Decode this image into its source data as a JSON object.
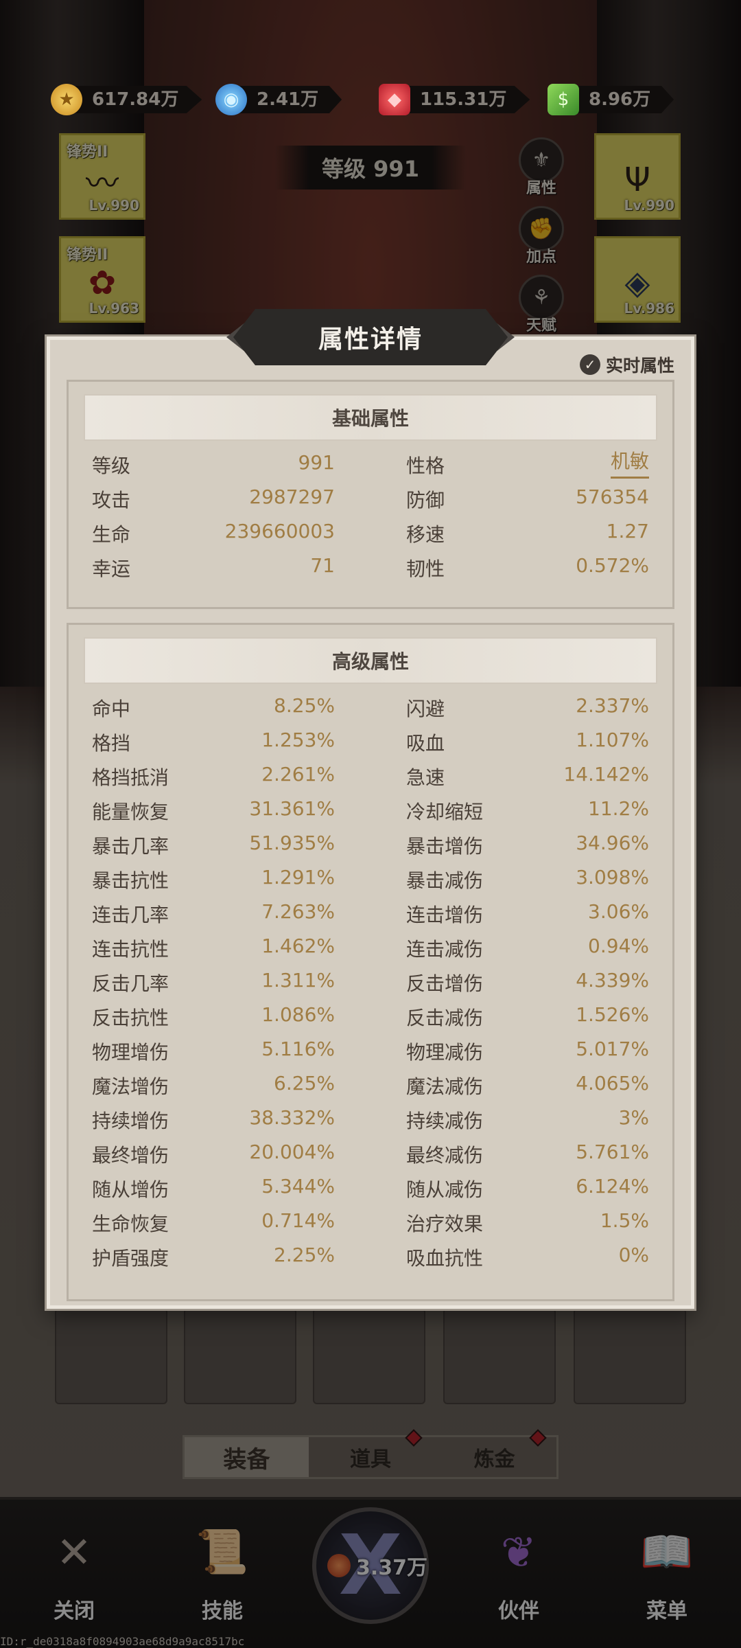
{
  "currencies": [
    {
      "icon": "gold-coin-icon",
      "glyph": "★",
      "value": "617.84万"
    },
    {
      "icon": "blue-orb-icon",
      "glyph": "◉",
      "value": "2.41万"
    },
    {
      "icon": "red-gem-icon",
      "glyph": "◆",
      "value": "115.31万"
    },
    {
      "icon": "green-cash-icon",
      "glyph": "$",
      "value": "8.96万"
    }
  ],
  "equipment": {
    "left": [
      {
        "name": "锋势II",
        "level": "Lv.990"
      },
      {
        "name": "锋势II",
        "level": "Lv.963"
      }
    ],
    "right": [
      {
        "level": "Lv.990"
      },
      {
        "level": "Lv.986"
      }
    ]
  },
  "level_banner": "等级 991",
  "side_buttons": [
    "属性",
    "加点",
    "天赋"
  ],
  "modal": {
    "title": "属性详情",
    "realtime_label": "实时属性",
    "basic": {
      "title": "基础属性",
      "rows": [
        [
          {
            "k": "等级",
            "v": "991"
          },
          {
            "k": "性格",
            "v": "机敏"
          }
        ],
        [
          {
            "k": "攻击",
            "v": "2987297"
          },
          {
            "k": "防御",
            "v": "576354"
          }
        ],
        [
          {
            "k": "生命",
            "v": "239660003"
          },
          {
            "k": "移速",
            "v": "1.27"
          }
        ],
        [
          {
            "k": "幸运",
            "v": "71"
          },
          {
            "k": "韧性",
            "v": "0.572%"
          }
        ]
      ]
    },
    "advanced": {
      "title": "高级属性",
      "rows": [
        [
          {
            "k": "命中",
            "v": "8.25%"
          },
          {
            "k": "闪避",
            "v": "2.337%"
          }
        ],
        [
          {
            "k": "格挡",
            "v": "1.253%"
          },
          {
            "k": "吸血",
            "v": "1.107%"
          }
        ],
        [
          {
            "k": "格挡抵消",
            "v": "2.261%"
          },
          {
            "k": "急速",
            "v": "14.142%"
          }
        ],
        [
          {
            "k": "能量恢复",
            "v": "31.361%"
          },
          {
            "k": "冷却缩短",
            "v": "11.2%"
          }
        ],
        [
          {
            "k": "暴击几率",
            "v": "51.935%"
          },
          {
            "k": "暴击增伤",
            "v": "34.96%"
          }
        ],
        [
          {
            "k": "暴击抗性",
            "v": "1.291%"
          },
          {
            "k": "暴击减伤",
            "v": "3.098%"
          }
        ],
        [
          {
            "k": "连击几率",
            "v": "7.263%"
          },
          {
            "k": "连击增伤",
            "v": "3.06%"
          }
        ],
        [
          {
            "k": "连击抗性",
            "v": "1.462%"
          },
          {
            "k": "连击减伤",
            "v": "0.94%"
          }
        ],
        [
          {
            "k": "反击几率",
            "v": "1.311%"
          },
          {
            "k": "反击增伤",
            "v": "4.339%"
          }
        ],
        [
          {
            "k": "反击抗性",
            "v": "1.086%"
          },
          {
            "k": "反击减伤",
            "v": "1.526%"
          }
        ],
        [
          {
            "k": "物理增伤",
            "v": "5.116%"
          },
          {
            "k": "物理减伤",
            "v": "5.017%"
          }
        ],
        [
          {
            "k": "魔法增伤",
            "v": "6.25%"
          },
          {
            "k": "魔法减伤",
            "v": "4.065%"
          }
        ],
        [
          {
            "k": "持续增伤",
            "v": "38.332%"
          },
          {
            "k": "持续减伤",
            "v": "3%"
          }
        ],
        [
          {
            "k": "最终增伤",
            "v": "20.004%"
          },
          {
            "k": "最终减伤",
            "v": "5.761%"
          }
        ],
        [
          {
            "k": "随从增伤",
            "v": "5.344%"
          },
          {
            "k": "随从减伤",
            "v": "6.124%"
          }
        ],
        [
          {
            "k": "生命恢复",
            "v": "0.714%"
          },
          {
            "k": "治疗效果",
            "v": "1.5%"
          }
        ],
        [
          {
            "k": "护盾强度",
            "v": "2.25%"
          },
          {
            "k": "吸血抗性",
            "v": "0%"
          }
        ]
      ]
    }
  },
  "inventory_tabs": [
    "装备",
    "道具",
    "炼金"
  ],
  "bottom_nav": {
    "close": "关闭",
    "skills": "技能",
    "center_cost": "3.37万",
    "partner": "伙伴",
    "menu": "菜单"
  },
  "footer_id": "ID:r_de0318a8f0894903ae68d9a9ac8517bc",
  "colors": {
    "modal_bg": "#d7d0c5",
    "value_text": "#a07d44",
    "label_text": "#4a4038",
    "title_bar": "#2b2927"
  }
}
